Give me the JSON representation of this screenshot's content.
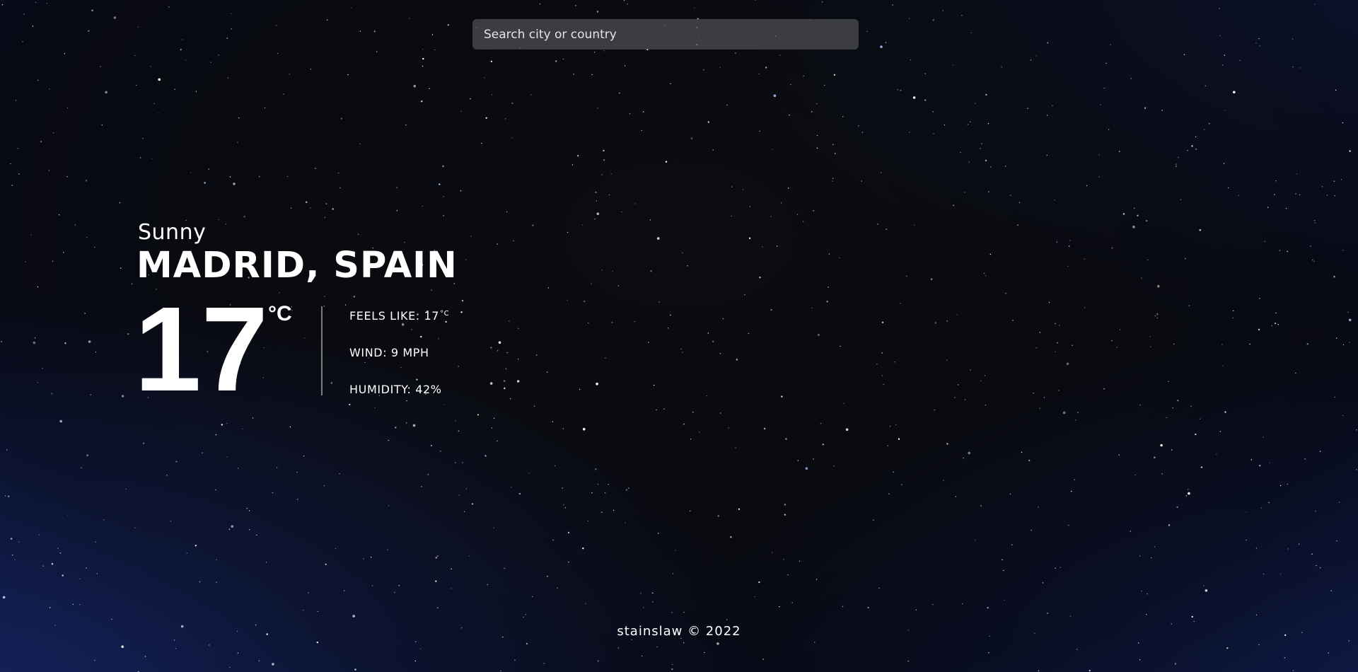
{
  "search": {
    "placeholder": "Search city or country"
  },
  "weather": {
    "condition": "Sunny",
    "location": "MADRID, SPAIN",
    "temperature": "17",
    "unit": "°C",
    "feels_like_label": "FEELS LIKE: 17",
    "feels_like_unit": "°C",
    "wind": "WIND: 9 MPH",
    "humidity": "HUMIDITY: 42%"
  },
  "footer": {
    "text": "stainslaw © 2022"
  },
  "colors": {
    "background": "#090a0f",
    "text": "#ffffff",
    "search_bg": "#505054",
    "divider": "#7d7d7d",
    "star": "#ffffff"
  }
}
